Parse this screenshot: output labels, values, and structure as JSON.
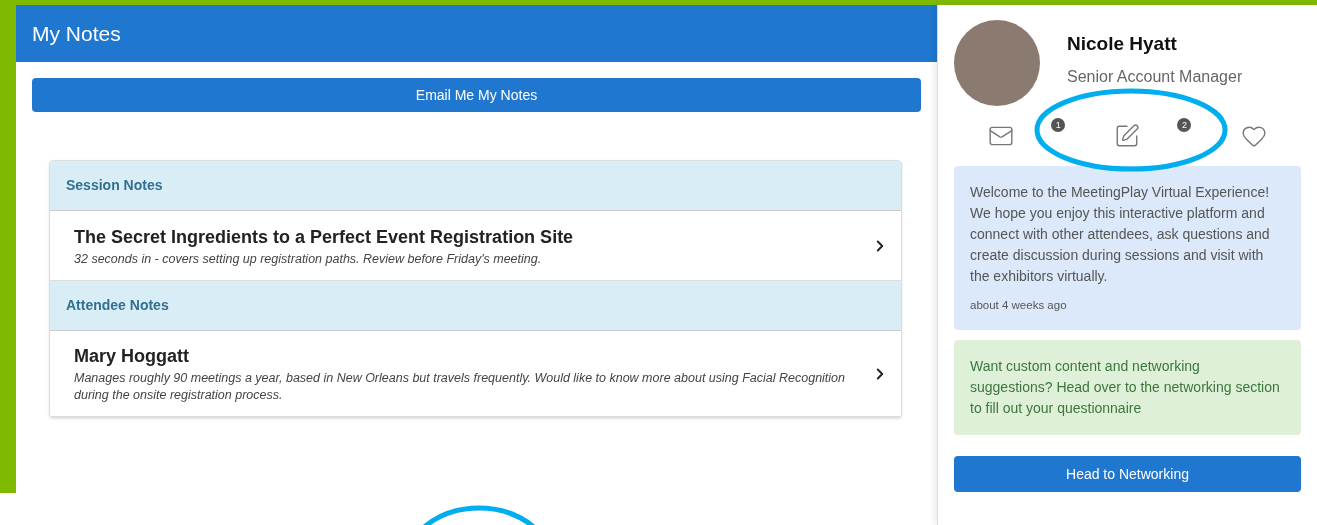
{
  "header": {
    "title": "My Notes"
  },
  "email_button": "Email Me My Notes",
  "notes": [
    {
      "heading": "Session Notes",
      "items": [
        {
          "title": "The Secret Ingredients to a Perfect Event Registration Site",
          "note": "32 seconds in - covers setting up registration paths. Review before Friday's meeting."
        }
      ]
    },
    {
      "heading": "Attendee Notes",
      "items": [
        {
          "title": "Mary Hoggatt",
          "note": "Manages roughly 90 meetings a year, based in New Orleans but travels frequently. Would like to know more about using Facial Recognition during the onsite registration process."
        }
      ]
    }
  ],
  "profile": {
    "name": "Nicole Hyatt",
    "role": "Senior Account Manager"
  },
  "actions": [
    {
      "kind": "mail",
      "badge": "1"
    },
    {
      "kind": "notes",
      "badge": "2"
    },
    {
      "kind": "favorite"
    }
  ],
  "messages": [
    {
      "kind": "info",
      "text": "Welcome to the MeetingPlay Virtual Experience! We hope you enjoy this interactive platform and connect with other attendees, ask questions and create discussion during sessions and visit with the exhibitors virtually.",
      "time": "about 4 weeks ago"
    },
    {
      "kind": "success",
      "text": "Want custom content and networking suggestions? Head over to the networking section to fill out your questionnaire"
    }
  ],
  "networking_button": "Head to Networking"
}
